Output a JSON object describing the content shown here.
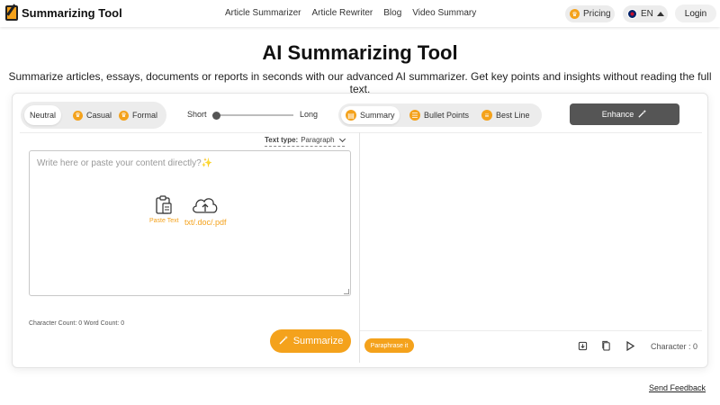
{
  "header": {
    "brand": "Summarizing Tool",
    "nav": [
      "Article Summarizer",
      "Article Rewriter",
      "Blog",
      "Video Summary"
    ],
    "pricing_label": "Pricing",
    "language_label": "EN",
    "login_label": "Login"
  },
  "hero": {
    "title": "AI Summarizing Tool",
    "subtitle": "Summarize articles, essays, documents or reports in seconds with our advanced AI summarizer. Get key points and insights without reading the full text."
  },
  "modes": {
    "items": [
      "Neutral",
      "Casual",
      "Formal"
    ],
    "selected": "Neutral"
  },
  "length": {
    "short_label": "Short",
    "long_label": "Long",
    "value": 0
  },
  "formats": {
    "items": [
      "Summary",
      "Bullet Points",
      "Best Line"
    ],
    "selected": "Summary"
  },
  "enhance_label": "Enhance",
  "editor": {
    "text_type_label": "Text type:",
    "text_type_value": "Paragraph",
    "placeholder": "Write here or paste your content directly?✨",
    "paste_label": "Paste Text",
    "upload_label": "txt/.doc/.pdf",
    "char_count_label": "Character Count: 0 Word Count: 0",
    "summarize_label": "Summarize"
  },
  "output": {
    "paraphrase_label": "Paraphrase it",
    "char_label": "Character : 0"
  },
  "feedback_label": "Send Feedback",
  "colors": {
    "accent": "#f4a21c",
    "dark_button": "#555555"
  }
}
